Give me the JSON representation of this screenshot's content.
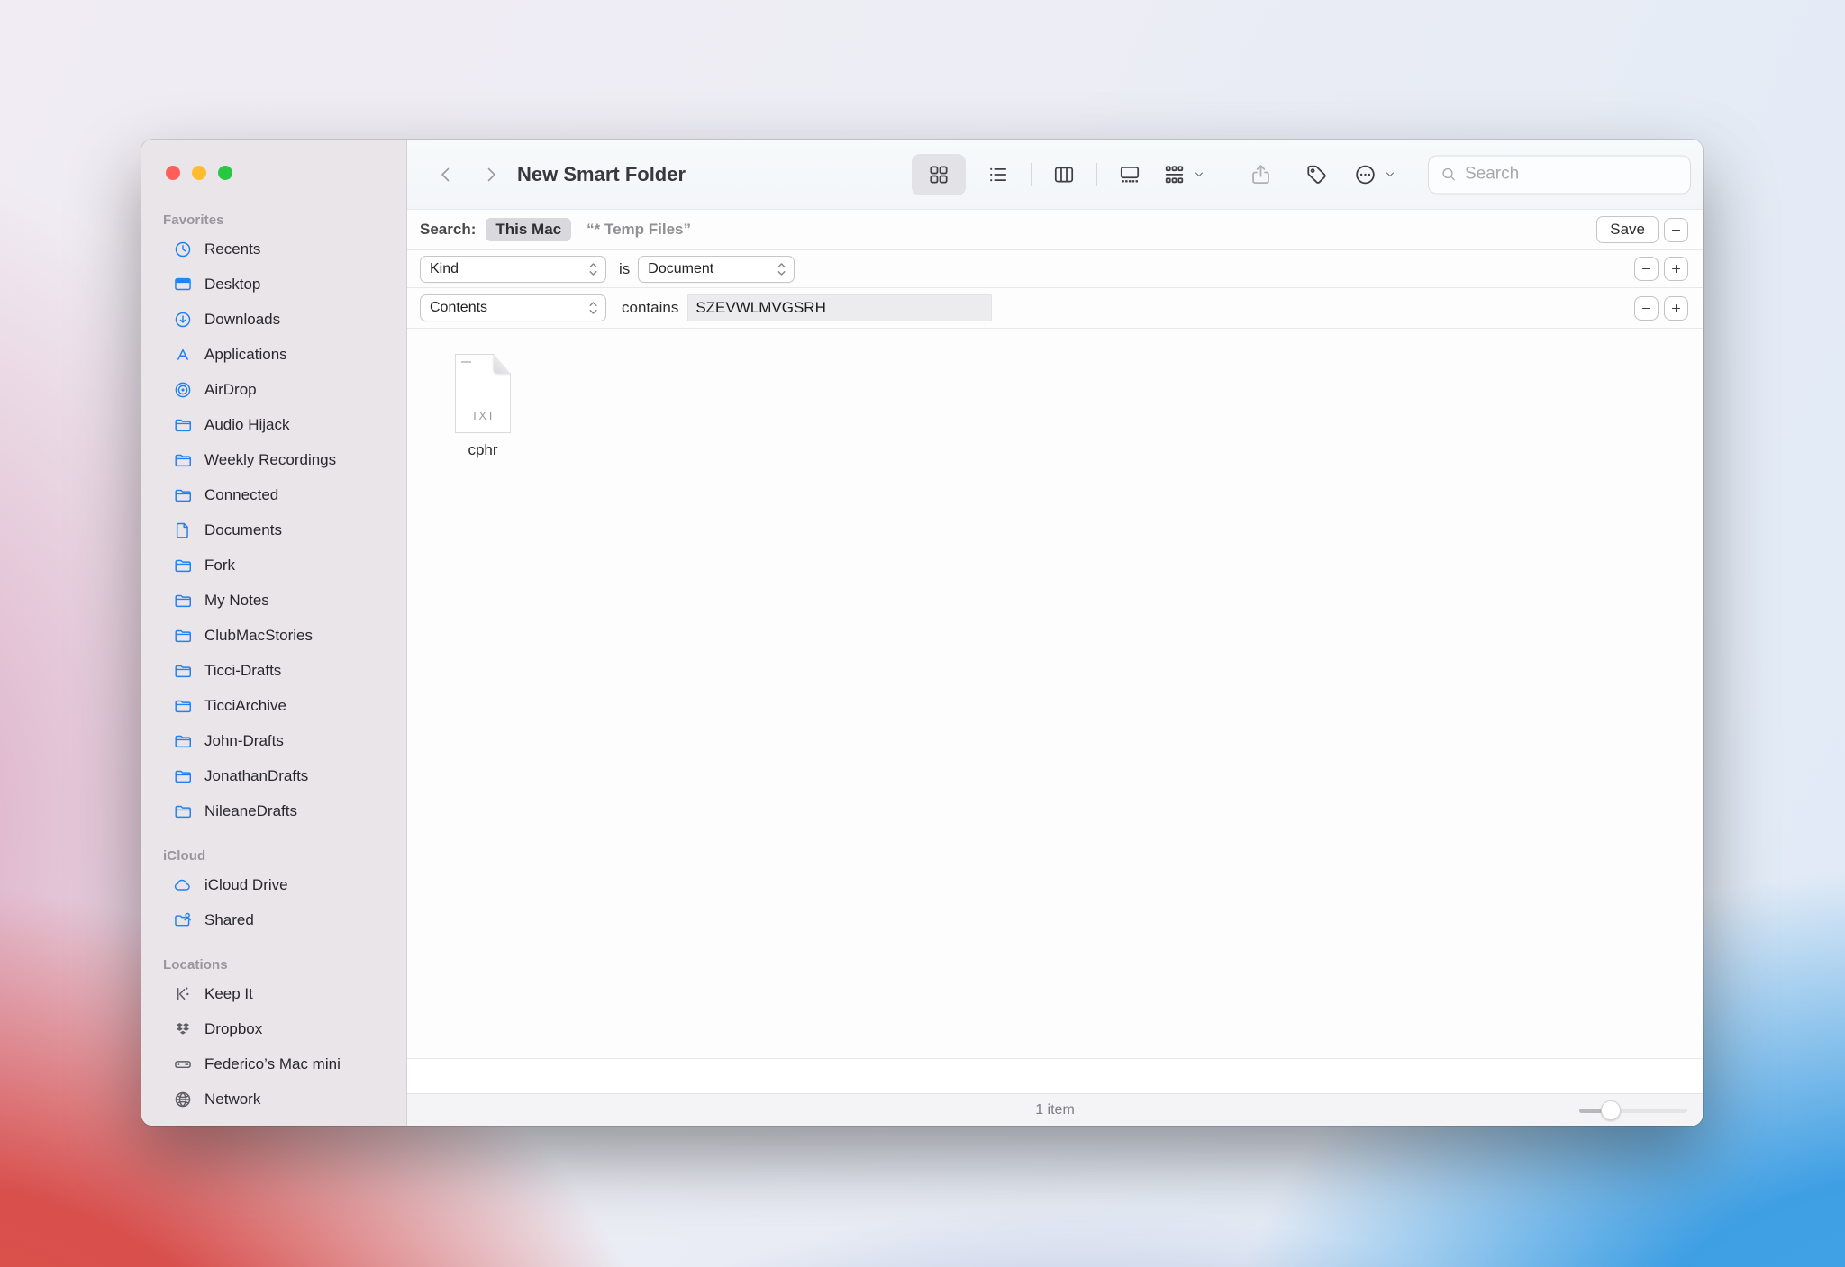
{
  "window": {
    "title": "New Smart Folder"
  },
  "toolbar": {
    "view_modes": [
      "icons",
      "list",
      "columns",
      "gallery"
    ],
    "icons": [
      "back-icon",
      "forward-icon",
      "grid-view-icon",
      "list-view-icon",
      "columns-view-icon",
      "gallery-view-icon",
      "group-by-icon",
      "share-icon",
      "tag-icon",
      "more-actions-icon",
      "search-icon"
    ],
    "search_placeholder": "Search"
  },
  "search_bar": {
    "label": "Search:",
    "scope_selected": "This Mac",
    "scope_query": "“* Temp Files”",
    "save_label": "Save"
  },
  "criteria": [
    {
      "attribute": "Kind",
      "operator": "is",
      "value": "Document"
    },
    {
      "attribute": "Contents",
      "operator": "contains",
      "value": "SZEVWLMVGSRH"
    }
  ],
  "sidebar": {
    "sections": [
      {
        "title": "Favorites",
        "items": [
          {
            "label": "Recents",
            "icon": "clock"
          },
          {
            "label": "Desktop",
            "icon": "desktop"
          },
          {
            "label": "Downloads",
            "icon": "download"
          },
          {
            "label": "Applications",
            "icon": "appstore"
          },
          {
            "label": "AirDrop",
            "icon": "airdrop"
          },
          {
            "label": "Audio Hijack",
            "icon": "folder"
          },
          {
            "label": "Weekly Recordings",
            "icon": "folder"
          },
          {
            "label": "Connected",
            "icon": "folder"
          },
          {
            "label": "Documents",
            "icon": "document"
          },
          {
            "label": "Fork",
            "icon": "folder"
          },
          {
            "label": "My Notes",
            "icon": "folder"
          },
          {
            "label": "ClubMacStories",
            "icon": "folder"
          },
          {
            "label": "Ticci-Drafts",
            "icon": "folder"
          },
          {
            "label": "TicciArchive",
            "icon": "folder"
          },
          {
            "label": "John-Drafts",
            "icon": "folder"
          },
          {
            "label": "JonathanDrafts",
            "icon": "folder"
          },
          {
            "label": "NileaneDrafts",
            "icon": "folder"
          }
        ]
      },
      {
        "title": "iCloud",
        "items": [
          {
            "label": "iCloud Drive",
            "icon": "cloud"
          },
          {
            "label": "Shared",
            "icon": "shared-folder"
          }
        ]
      },
      {
        "title": "Locations",
        "items": [
          {
            "label": "Keep It",
            "icon": "keepit",
            "tint": "gray"
          },
          {
            "label": "Dropbox",
            "icon": "dropbox",
            "tint": "gray"
          },
          {
            "label": "Federico’s Mac mini",
            "icon": "macmini",
            "tint": "gray"
          },
          {
            "label": "Network",
            "icon": "globe",
            "tint": "gray"
          }
        ]
      }
    ]
  },
  "content": {
    "files": [
      {
        "name": "cphr",
        "badge": "TXT"
      }
    ]
  },
  "status_bar": {
    "items_text": "1 item"
  },
  "colors": {
    "traffic_close": "#ff5f57",
    "traffic_minimize": "#febc2e",
    "traffic_zoom": "#28c840",
    "sidebar_icon_blue": "#2082f0",
    "selected_pill_gray": "#d9d9dd",
    "wallpaper_corners": [
      "#f1ecf3",
      "#dfeaf6",
      "#d84f4c",
      "#41a8e9"
    ]
  }
}
